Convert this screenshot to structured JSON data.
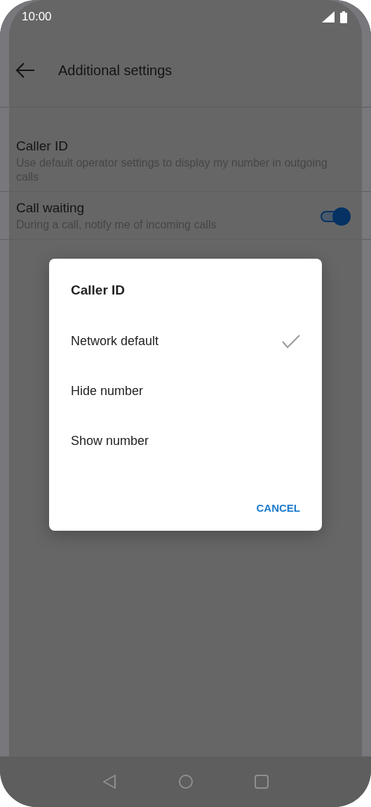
{
  "status_bar": {
    "time": "10:00"
  },
  "app_bar": {
    "title": "Additional settings"
  },
  "settings": [
    {
      "kind": "text",
      "title": "Caller ID",
      "summary": "Use default operator settings to display my number in outgoing calls"
    },
    {
      "kind": "switch",
      "title": "Call waiting",
      "summary": "During a call, notify me of incoming calls",
      "on": true
    }
  ],
  "dialog": {
    "title": "Caller ID",
    "options": [
      {
        "label": "Network default",
        "selected": true
      },
      {
        "label": "Hide number",
        "selected": false
      },
      {
        "label": "Show number",
        "selected": false
      }
    ],
    "buttons": [
      "CANCEL"
    ]
  }
}
